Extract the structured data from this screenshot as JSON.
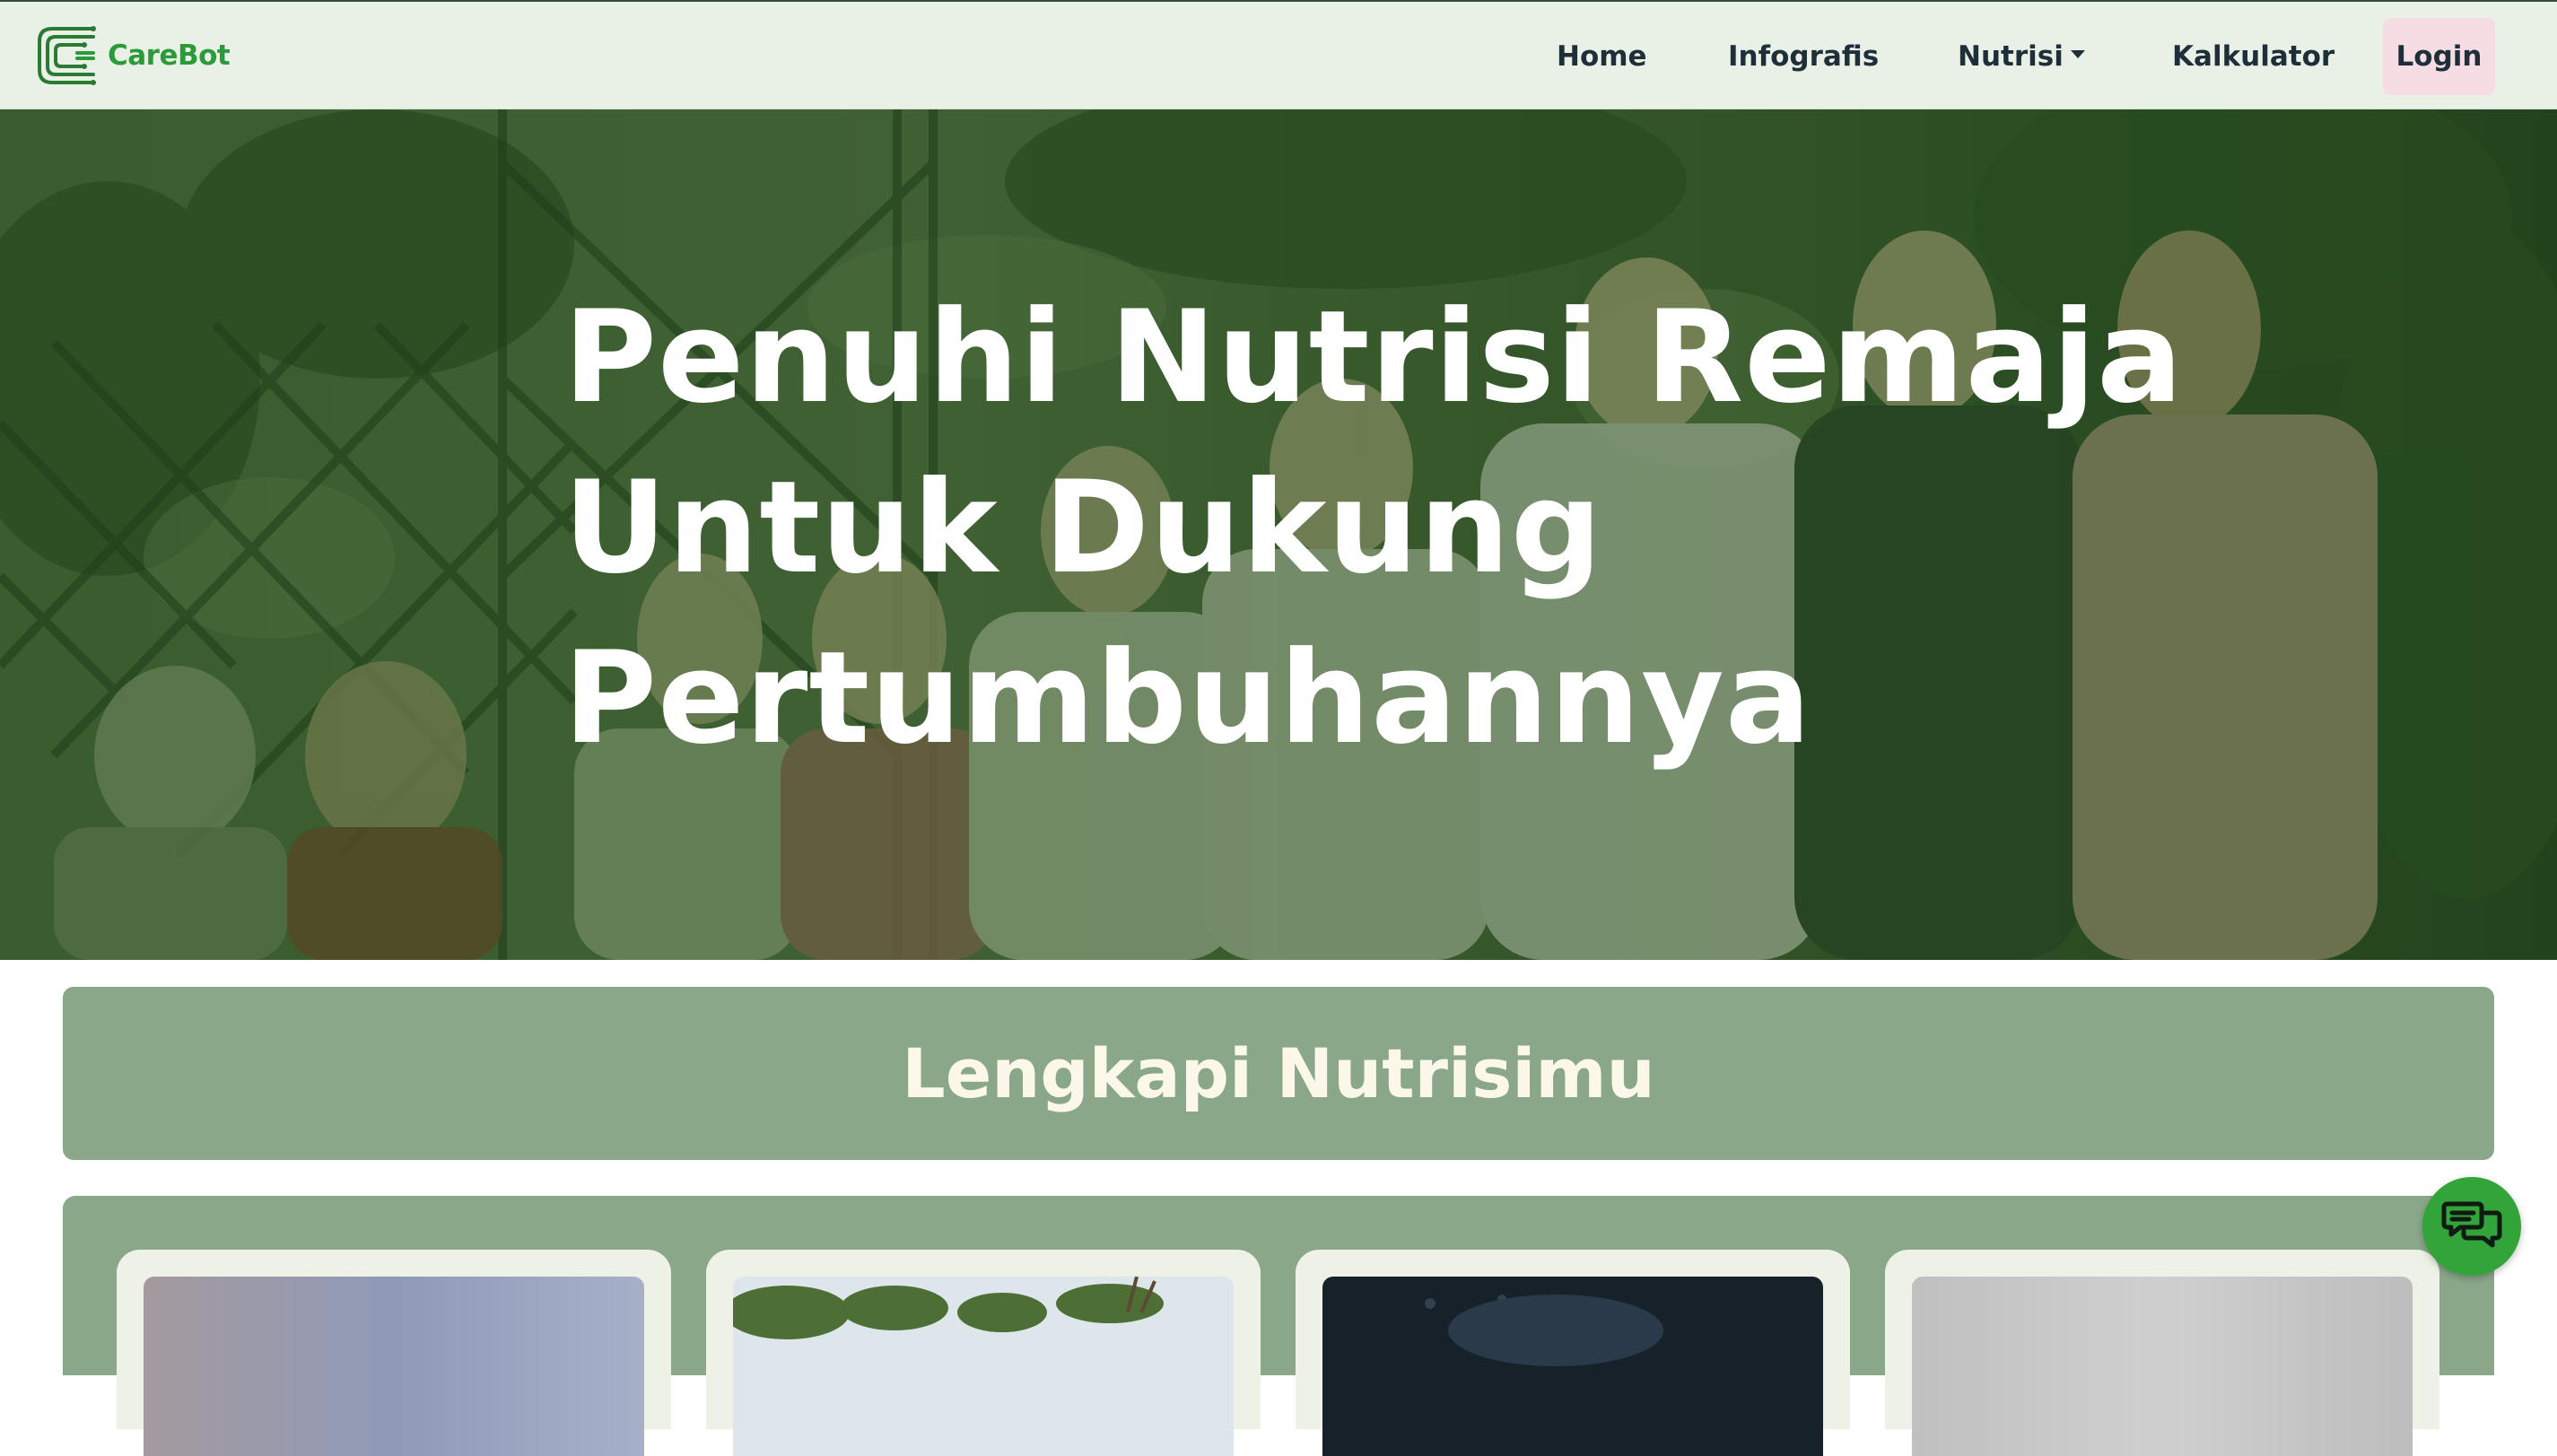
{
  "brand": {
    "name": "CareBot",
    "logo_icon": "carebot-c-logo-icon",
    "color": "#2b9a3a"
  },
  "nav": {
    "home": "Home",
    "infografis": "Infografis",
    "nutrisi": "Nutrisi",
    "kalkulator": "Kalkulator",
    "login": "Login"
  },
  "hero": {
    "title_lines": [
      "Penuhi Nutrisi Remaja",
      "Untuk Dukung",
      "Pertumbuhannya"
    ],
    "overlay_color": "#1f4a1a",
    "image": "group of children and teenagers standing in a garden"
  },
  "section": {
    "title": "Lengkapi Nutrisimu"
  },
  "cards": [
    {
      "image": "card-image-1"
    },
    {
      "image": "card-image-2"
    },
    {
      "image": "card-image-3"
    },
    {
      "image": "card-image-4"
    }
  ],
  "chat": {
    "icon": "chat-bubbles-icon",
    "color": "#33a43a"
  },
  "colors": {
    "navbar_bg": "#e9f1e6",
    "nav_text": "#1f2f3a",
    "login_bg": "#f6dde3",
    "section_bg": "#8aa78a",
    "section_text": "#fbf8ea",
    "card_bg": "#eef2e6"
  }
}
